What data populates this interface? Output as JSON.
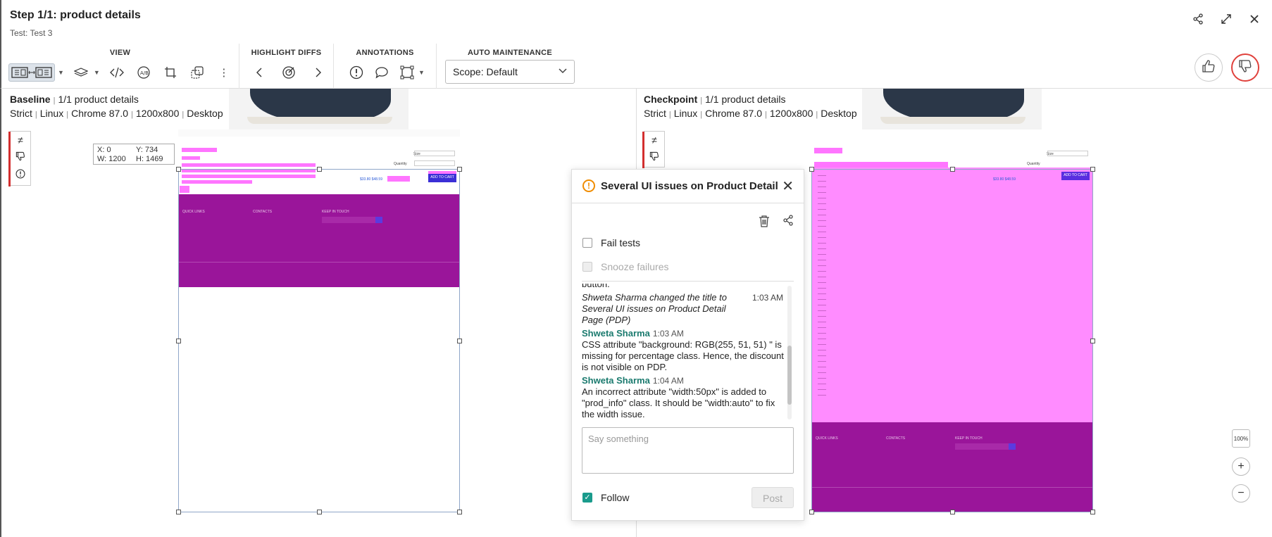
{
  "header": {
    "title": "Step 1/1: product details",
    "subtitle": "Test: Test 3",
    "icons": [
      "share-icon",
      "expand-icon",
      "close-icon"
    ]
  },
  "toolbar": {
    "view_label": "VIEW",
    "highlight_label": "HIGHLIGHT DIFFS",
    "annotations_label": "ANNOTATIONS",
    "auto_label": "AUTO MAINTENANCE",
    "scope_value": "Scope: Default"
  },
  "baseline": {
    "title": "Baseline",
    "step": "1/1 product details",
    "match": "Strict",
    "os": "Linux",
    "browser": "Chrome 87.0",
    "size": "1200x800",
    "device": "Desktop",
    "coords": {
      "x": "X: 0",
      "y": "Y: 734",
      "w": "W: 1200",
      "h": "H: 1469"
    }
  },
  "checkpoint": {
    "title": "Checkpoint",
    "step": "1/1 product details",
    "match": "Strict",
    "os": "Linux",
    "browser": "Chrome 87.0",
    "size": "1200x800",
    "device": "Desktop"
  },
  "dialog": {
    "title": "Several UI issues on Product Detail P",
    "fail_tests": "Fail tests",
    "snooze": "Snooze failures",
    "partial_top": "button.",
    "comments": [
      {
        "type": "system",
        "text": "Shweta Sharma changed the title to Several UI issues on Product Detail Page (PDP)",
        "time": "1:03 AM"
      },
      {
        "type": "user",
        "author": "Shweta Sharma",
        "time": "1:03 AM",
        "text": "CSS attribute \"background: RGB(255, 51, 51) \" is missing for percentage class. Hence, the discount is not visible on PDP."
      },
      {
        "type": "user",
        "author": "Shweta Sharma",
        "time": "1:04 AM",
        "text": "An incorrect attribute \"width:50px\" is added to \"prod_info\" class. It should be \"width:auto\" to fix the width issue."
      }
    ],
    "placeholder": "Say something",
    "follow": "Follow",
    "post": "Post"
  },
  "zoom": {
    "fit": "100%"
  }
}
